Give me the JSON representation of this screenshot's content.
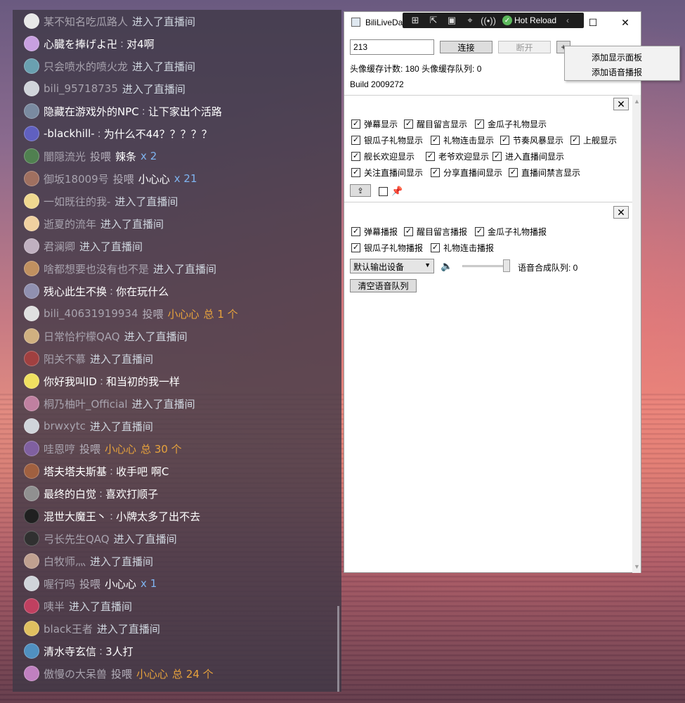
{
  "danmaku": [
    {
      "type": "enter",
      "user": "某不知名吃瓜路人",
      "action": "进入了直播间",
      "avatar_color": "#e8e8e8"
    },
    {
      "type": "chat",
      "user": "心臓を捧げよ卍",
      "sep": ":",
      "message": "对4啊",
      "avatar_color": "#c8a0e0"
    },
    {
      "type": "enter",
      "user": "只会喷水的喷火龙",
      "action": "进入了直播间",
      "avatar_color": "#6aa0b0"
    },
    {
      "type": "enter",
      "user": "bili_95718735",
      "action": "进入了直播间",
      "avatar_color": "#d0d4da"
    },
    {
      "type": "chat",
      "user": "隐藏在游戏外的NPC",
      "sep": ":",
      "message": "让下家出个活路",
      "avatar_color": "#7a8aa0"
    },
    {
      "type": "chat",
      "user": "-blackhill-",
      "sep": ":",
      "message": "为什么不44？？？？？",
      "avatar_color": "#6060c0"
    },
    {
      "type": "gift",
      "user": "闇隠流光",
      "action": "投喂",
      "gift": "辣条",
      "count": "x 2",
      "gift_style": "white",
      "count_style": "blue",
      "avatar_color": "#508050"
    },
    {
      "type": "gift",
      "user": "御坂18009号",
      "action": "投喂",
      "gift": "小心心",
      "count": "x 21",
      "gift_style": "white",
      "count_style": "blue",
      "avatar_color": "#a07060"
    },
    {
      "type": "enter",
      "user": "一如既往的我-",
      "action": "进入了直播间",
      "avatar_color": "#f0d890"
    },
    {
      "type": "enter",
      "user": "逝夏的流年",
      "action": "进入了直播间",
      "avatar_color": "#f0d0a0"
    },
    {
      "type": "enter",
      "user": "君澜卿",
      "action": "进入了直播间",
      "avatar_color": "#c0b0c0"
    },
    {
      "type": "enter",
      "user": "啥都想要也没有也不是",
      "action": "进入了直播间",
      "avatar_color": "#c09060"
    },
    {
      "type": "chat",
      "user": "残心此生不换",
      "sep": ":",
      "message": "你在玩什么",
      "avatar_color": "#9090b0"
    },
    {
      "type": "gift",
      "user": "bili_40631919934",
      "action": "投喂",
      "gift": "小心心",
      "count": "总 1 个",
      "gift_style": "gold",
      "count_style": "gold",
      "avatar_color": "#e0e0e0"
    },
    {
      "type": "enter",
      "user": "日常恰柠檬QAQ",
      "action": "进入了直播间",
      "avatar_color": "#d0b080"
    },
    {
      "type": "enter",
      "user": "阳关不慕",
      "action": "进入了直播间",
      "avatar_color": "#a04040"
    },
    {
      "type": "chat",
      "user": "你好我叫ID",
      "sep": ":",
      "message": "和当初的我一样",
      "avatar_color": "#f0e060"
    },
    {
      "type": "enter",
      "user": "桐乃柚叶_Official",
      "action": "进入了直播间",
      "avatar_color": "#c080a0"
    },
    {
      "type": "enter",
      "user": "brwxytc",
      "action": "进入了直播间",
      "avatar_color": "#d0d4da"
    },
    {
      "type": "gift",
      "user": "哇恩哼",
      "action": "投喂",
      "gift": "小心心",
      "count": "总 30 个",
      "gift_style": "gold",
      "count_style": "gold",
      "avatar_color": "#8060a0"
    },
    {
      "type": "chat",
      "user": "塔夫塔夫斯基",
      "sep": ":",
      "message": "收手吧 啊C",
      "avatar_color": "#a06040"
    },
    {
      "type": "chat",
      "user": "最终的白觉",
      "sep": ":",
      "message": "喜欢打顺子",
      "avatar_color": "#909090"
    },
    {
      "type": "chat",
      "user": "混世大魔王丶",
      "sep": ":",
      "message": "小牌太多了出不去",
      "avatar_color": "#202020"
    },
    {
      "type": "enter",
      "user": "弓长先生QAQ",
      "action": "进入了直播间",
      "avatar_color": "#303030"
    },
    {
      "type": "enter",
      "user": "白牧师灬",
      "action": "进入了直播间",
      "avatar_color": "#c0a090"
    },
    {
      "type": "gift",
      "user": "喔行吗",
      "action": "投喂",
      "gift": "小心心",
      "count": "x 1",
      "gift_style": "white",
      "count_style": "blue",
      "avatar_color": "#d0d4da"
    },
    {
      "type": "enter",
      "user": "咦半",
      "action": "进入了直播间",
      "avatar_color": "#c04060"
    },
    {
      "type": "enter",
      "user": "black王者",
      "action": "进入了直播间",
      "avatar_color": "#e0c060"
    },
    {
      "type": "chat",
      "user": "清水寺玄信",
      "sep": ":",
      "message": "3人打",
      "avatar_color": "#5090c0"
    },
    {
      "type": "gift",
      "user": "傲慢の大呆兽",
      "action": "投喂",
      "gift": "小心心",
      "count": "总 24 个",
      "gift_style": "gold",
      "count_style": "gold",
      "avatar_color": "#c080c0"
    }
  ],
  "window": {
    "title": "BiliLiveDa",
    "hot_reload": "Hot Reload",
    "room_id": "213",
    "connect_label": "连接",
    "disconnect_label": "断开",
    "add_label": "+",
    "cache_text": "头像缓存计数: 180  头像缓存队列: 0",
    "build_text": "Build 2009272",
    "context_menu": [
      "添加显示面板",
      "添加语音播报"
    ]
  },
  "display_panel": {
    "options": [
      {
        "label": "弹幕显示",
        "checked": true
      },
      {
        "label": "醒目留言显示",
        "checked": true
      },
      {
        "label": "金瓜子礼物显示",
        "checked": true
      },
      {
        "label": "银瓜子礼物显示",
        "checked": true
      },
      {
        "label": "礼物连击显示",
        "checked": true
      },
      {
        "label": "节奏风暴显示",
        "checked": true
      },
      {
        "label": "上舰显示",
        "checked": true
      },
      {
        "label": "舰长欢迎显示",
        "checked": true
      },
      {
        "label": "老爷欢迎显示",
        "checked": true
      },
      {
        "label": "进入直播间显示",
        "checked": true
      },
      {
        "label": "关注直播间显示",
        "checked": true
      },
      {
        "label": "分享直播间显示",
        "checked": true
      },
      {
        "label": "直播间禁言显示",
        "checked": true
      }
    ],
    "pin_checked": false
  },
  "voice_panel": {
    "options": [
      {
        "label": "弹幕播报",
        "checked": true
      },
      {
        "label": "醒目留言播报",
        "checked": true
      },
      {
        "label": "金瓜子礼物播报",
        "checked": true
      },
      {
        "label": "银瓜子礼物播报",
        "checked": true
      },
      {
        "label": "礼物连击播报",
        "checked": true
      }
    ],
    "output_device": "默认输出设备",
    "volume": 1.0,
    "queue_text": "语音合成队列: 0",
    "clear_label": "清空语音队列"
  }
}
